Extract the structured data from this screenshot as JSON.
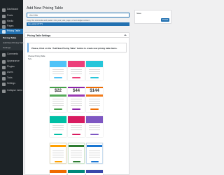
{
  "sidebar": {
    "items": [
      {
        "label": "Dashboard",
        "icon": "dashboard-icon"
      },
      {
        "label": "Posts",
        "icon": "pin-icon"
      },
      {
        "label": "Media",
        "icon": "media-icon"
      },
      {
        "label": "Pages",
        "icon": "page-icon"
      },
      {
        "label": "Pricing Table",
        "icon": "table-icon",
        "active": true
      },
      {
        "label": "Comments",
        "icon": "comment-icon"
      },
      {
        "label": "Appearance",
        "icon": "brush-icon"
      },
      {
        "label": "Plugins",
        "icon": "plugin-icon"
      },
      {
        "label": "Users",
        "icon": "users-icon"
      },
      {
        "label": "Tools",
        "icon": "wrench-icon"
      },
      {
        "label": "Settings",
        "icon": "settings-icon"
      },
      {
        "label": "Collapse menu",
        "icon": "collapse-icon"
      }
    ],
    "submenu": [
      "Pricing Table",
      "Add New Pricing Table",
      "Settings"
    ]
  },
  "main": {
    "page_title": "Add New Pricing Table",
    "title_placeholder": "Add title",
    "shortcode_hint": "Copy this shortcode and paste it into your post, page, or text widget content:",
    "shortcode": "[sp_wpcp id=\"0\"]"
  },
  "publish": {
    "heading": "Save",
    "status": "",
    "button_label": "Publish"
  },
  "settings": {
    "title": "Pricing Table Settings",
    "notice": "Please, Click on the \"Add New Pricing Table\" button to create new pricing table Items.",
    "style_label": "Choose Pricing Table",
    "style_sublabel": "Style"
  },
  "templates": [
    {
      "name": "template-1",
      "colors": [
        "#4fc3f7",
        "#ec407a",
        "#26c6da"
      ]
    },
    {
      "name": "template-2",
      "colors": [
        "#43a047",
        "#8e24aa",
        "#ef6c00"
      ],
      "prices": [
        "$22",
        "$44",
        "$144"
      ]
    },
    {
      "name": "template-3",
      "colors": [
        "#00bfa5",
        "#d81b60",
        "#7e57c2"
      ]
    },
    {
      "name": "template-4",
      "colors": [
        "#ffa000",
        "#2e7d32",
        "#1976d2"
      ]
    },
    {
      "name": "template-5",
      "colors": [
        "#ef6c00",
        "#00897b",
        "#3949ab"
      ]
    }
  ],
  "accent_color": "#2271b1"
}
